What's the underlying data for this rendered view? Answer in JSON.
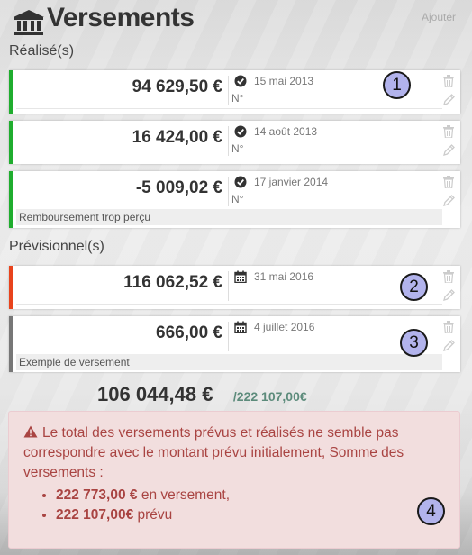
{
  "header": {
    "title": "Versements",
    "add_label": "Ajouter"
  },
  "sections": {
    "realises_title": "Réalisé(s)",
    "previsionnels_title": "Prévisionnel(s)"
  },
  "realises": [
    {
      "amount": "94 629,50 €",
      "date": "15 mai 2013",
      "num_label": "N°",
      "note": "",
      "status": "done",
      "bar_color": "#1fad2e"
    },
    {
      "amount": "16 424,00 €",
      "date": "14 août 2013",
      "num_label": "N°",
      "note": "",
      "status": "done",
      "bar_color": "#1fad2e"
    },
    {
      "amount": "-5 009,02 €",
      "date": "17 janvier 2014",
      "num_label": "N°",
      "note": "Remboursement trop perçu",
      "status": "done",
      "bar_color": "#1fad2e"
    }
  ],
  "previsionnels": [
    {
      "amount": "116 062,52 €",
      "date": "31 mai 2016",
      "note": "",
      "status": "planned",
      "bar_color": "#e8431c"
    },
    {
      "amount": "666,00 €",
      "date": "4 juillet 2016",
      "note": "Exemple de versement",
      "status": "planned",
      "bar_color": "#777777"
    }
  ],
  "totals": {
    "total": "106 044,48 €",
    "planned": "/222 107,00€"
  },
  "alert": {
    "message": "Le total des versements prévus et réalisés ne semble pas correspondre avec le montant prévu initialement, Somme des versements :",
    "item1_value": "222 773,00 €",
    "item1_suffix": " en versement,",
    "item2_value": "222 107,00€",
    "item2_suffix": " prévu"
  },
  "markers": [
    "1",
    "2",
    "3",
    "4"
  ],
  "icons": {
    "header": "bank-icon",
    "status_done": "check-circle-icon",
    "status_planned": "calendar-icon",
    "delete": "trash-icon",
    "edit": "pencil-icon",
    "alert": "warning-icon"
  }
}
